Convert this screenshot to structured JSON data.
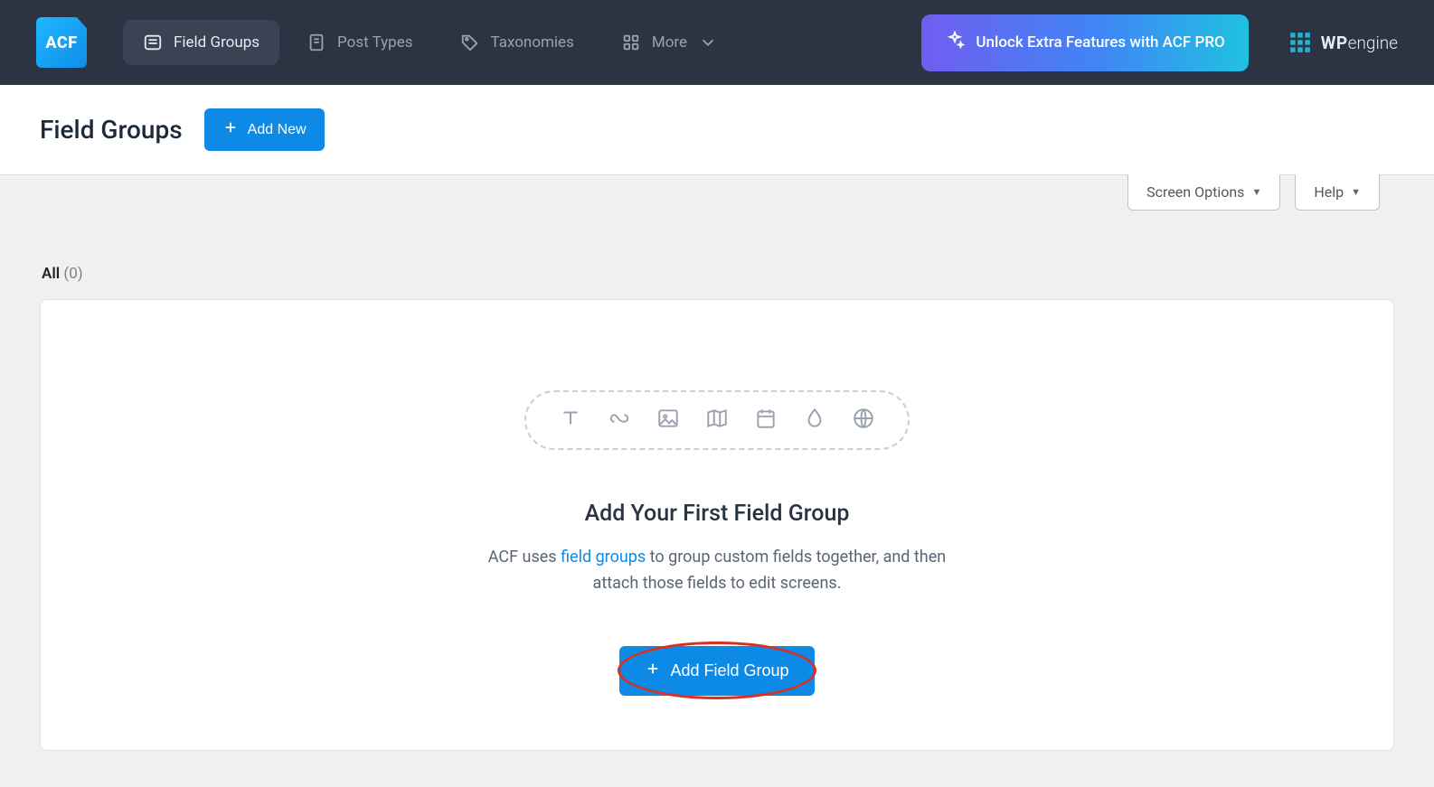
{
  "brand": {
    "logo_text": "ACF"
  },
  "nav": {
    "items": [
      {
        "label": "Field Groups",
        "icon": "list-icon",
        "active": true
      },
      {
        "label": "Post Types",
        "icon": "post-icon"
      },
      {
        "label": "Taxonomies",
        "icon": "tag-icon"
      },
      {
        "label": "More",
        "icon": "grid-icon",
        "has_chevron": true
      }
    ],
    "pro_label": "Unlock Extra Features with ACF PRO",
    "wpengine": {
      "wp": "WP",
      "engine": "engine"
    }
  },
  "page": {
    "title": "Field Groups",
    "add_new_label": "Add New"
  },
  "options": {
    "screen_options_label": "Screen Options",
    "help_label": "Help"
  },
  "filters": {
    "all_label": "All",
    "all_count": "(0)"
  },
  "empty": {
    "title": "Add Your First Field Group",
    "desc_prefix": "ACF uses ",
    "desc_link": "field groups",
    "desc_suffix": " to group custom fields together, and then attach those fields to edit screens.",
    "cta_label": "Add Field Group"
  }
}
